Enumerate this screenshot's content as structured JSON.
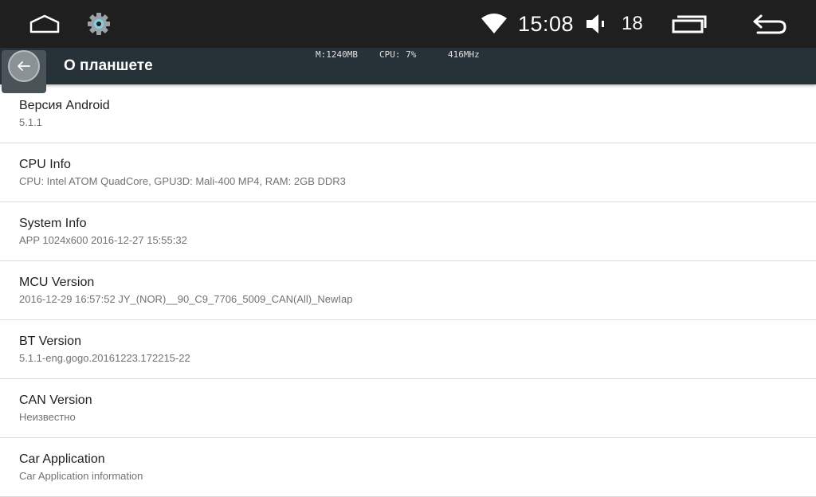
{
  "status_bar": {
    "time": "15:08",
    "volume": "18",
    "icons": {
      "home": "home-icon",
      "settings": "gear-icon",
      "wifi": "wifi-icon",
      "volume": "speaker-icon",
      "recents": "recents-icon",
      "back": "back-arrow-icon"
    }
  },
  "action_bar": {
    "title": "О планшете",
    "back_icon": "arrow-left-icon"
  },
  "debug_overlay": {
    "memory": "M:1240MB",
    "cpu": "CPU: 7%",
    "frequency": "416MHz"
  },
  "items": [
    {
      "title": "Версия Android",
      "subtitle": "5.1.1"
    },
    {
      "title": "CPU Info",
      "subtitle": "CPU: Intel ATOM QuadCore, GPU3D: Mali-400 MP4, RAM: 2GB DDR3"
    },
    {
      "title": "System Info",
      "subtitle": "APP 1024x600 2016-12-27 15:55:32"
    },
    {
      "title": "MCU Version",
      "subtitle": "2016-12-29 16:57:52 JY_(NOR)__90_C9_7706_5009_CAN(All)_NewIap"
    },
    {
      "title": "BT Version",
      "subtitle": "5.1.1-eng.gogo.20161223.172215-22"
    },
    {
      "title": "CAN Version",
      "subtitle": "Неизвестно"
    },
    {
      "title": "Car Application",
      "subtitle": "Car Application information"
    }
  ],
  "colors": {
    "status_bar_bg": "#1f1f1f",
    "action_bar_bg": "#263238",
    "gear_accent": "#7fd3e3",
    "divider": "#dcdcdc"
  }
}
